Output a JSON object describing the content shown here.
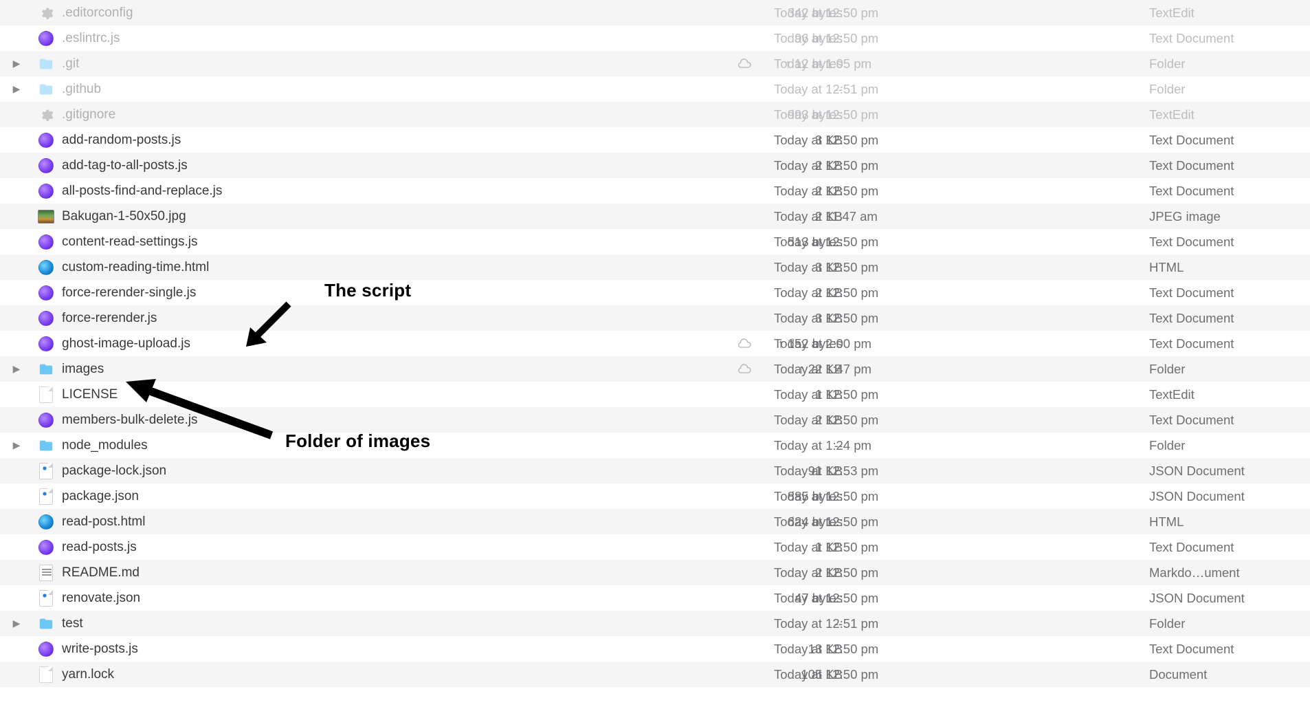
{
  "annotations": {
    "script_label": "The script",
    "folder_label": "Folder of images"
  },
  "rows": [
    {
      "name": ".editorconfig",
      "modified": "Today at 12:50 pm",
      "size": "342 bytes",
      "kind": "TextEdit",
      "icon": "gear",
      "expandable": false,
      "cloud": "none",
      "dim": true,
      "alt": true
    },
    {
      "name": ".eslintrc.js",
      "modified": "Today at 12:50 pm",
      "size": "96 bytes",
      "kind": "Text Document",
      "icon": "js",
      "expandable": false,
      "cloud": "none",
      "dim": true,
      "alt": false
    },
    {
      "name": ".git",
      "modified": "Today at 1:05 pm",
      "size": "↑ 12 bytes",
      "kind": "Folder",
      "icon": "folder",
      "expandable": true,
      "cloud": "cloud",
      "dim": true,
      "alt": true
    },
    {
      "name": ".github",
      "modified": "Today at 12:51 pm",
      "size": "--",
      "kind": "Folder",
      "icon": "folder",
      "expandable": true,
      "cloud": "none",
      "dim": true,
      "alt": false
    },
    {
      "name": ".gitignore",
      "modified": "Today at 12:50 pm",
      "size": "993 bytes",
      "kind": "TextEdit",
      "icon": "gear",
      "expandable": false,
      "cloud": "none",
      "dim": true,
      "alt": true
    },
    {
      "name": "add-random-posts.js",
      "modified": "Today at 12:50 pm",
      "size": "3 KB",
      "kind": "Text Document",
      "icon": "js",
      "expandable": false,
      "cloud": "none",
      "dim": false,
      "alt": false
    },
    {
      "name": "add-tag-to-all-posts.js",
      "modified": "Today at 12:50 pm",
      "size": "2 KB",
      "kind": "Text Document",
      "icon": "js",
      "expandable": false,
      "cloud": "none",
      "dim": false,
      "alt": true
    },
    {
      "name": "all-posts-find-and-replace.js",
      "modified": "Today at 12:50 pm",
      "size": "2 KB",
      "kind": "Text Document",
      "icon": "js",
      "expandable": false,
      "cloud": "none",
      "dim": false,
      "alt": false
    },
    {
      "name": "Bakugan-1-50x50.jpg",
      "modified": "Today at 11:47 am",
      "size": "2 KB",
      "kind": "JPEG image",
      "icon": "thumb",
      "expandable": false,
      "cloud": "none",
      "dim": false,
      "alt": true
    },
    {
      "name": "content-read-settings.js",
      "modified": "Today at 12:50 pm",
      "size": "513 bytes",
      "kind": "Text Document",
      "icon": "js",
      "expandable": false,
      "cloud": "none",
      "dim": false,
      "alt": false
    },
    {
      "name": "custom-reading-time.html",
      "modified": "Today at 12:50 pm",
      "size": "3 KB",
      "kind": "HTML",
      "icon": "html",
      "expandable": false,
      "cloud": "none",
      "dim": false,
      "alt": true
    },
    {
      "name": "force-rerender-single.js",
      "modified": "Today at 12:50 pm",
      "size": "2 KB",
      "kind": "Text Document",
      "icon": "js",
      "expandable": false,
      "cloud": "none",
      "dim": false,
      "alt": false
    },
    {
      "name": "force-rerender.js",
      "modified": "Today at 12:50 pm",
      "size": "3 KB",
      "kind": "Text Document",
      "icon": "js",
      "expandable": false,
      "cloud": "none",
      "dim": false,
      "alt": true
    },
    {
      "name": "ghost-image-upload.js",
      "modified": "Today at 2:00 pm",
      "size": "↑ 152 bytes",
      "kind": "Text Document",
      "icon": "js",
      "expandable": false,
      "cloud": "cloud",
      "dim": false,
      "alt": false
    },
    {
      "name": "images",
      "modified": "Today at 1:47 pm",
      "size": "↑ 22 KB",
      "kind": "Folder",
      "icon": "folder",
      "expandable": true,
      "cloud": "cloud",
      "dim": false,
      "alt": true
    },
    {
      "name": "LICENSE",
      "modified": "Today at 12:50 pm",
      "size": "1 KB",
      "kind": "TextEdit",
      "icon": "blank",
      "expandable": false,
      "cloud": "none",
      "dim": false,
      "alt": false
    },
    {
      "name": "members-bulk-delete.js",
      "modified": "Today at 12:50 pm",
      "size": "2 KB",
      "kind": "Text Document",
      "icon": "js",
      "expandable": false,
      "cloud": "none",
      "dim": false,
      "alt": true
    },
    {
      "name": "node_modules",
      "modified": "Today at 1:24 pm",
      "size": "--",
      "kind": "Folder",
      "icon": "folder",
      "expandable": true,
      "cloud": "none",
      "dim": false,
      "alt": false
    },
    {
      "name": "package-lock.json",
      "modified": "Today at 12:53 pm",
      "size": "91 KB",
      "kind": "JSON Document",
      "icon": "json",
      "expandable": false,
      "cloud": "none",
      "dim": false,
      "alt": true
    },
    {
      "name": "package.json",
      "modified": "Today at 12:50 pm",
      "size": "885 bytes",
      "kind": "JSON Document",
      "icon": "json",
      "expandable": false,
      "cloud": "none",
      "dim": false,
      "alt": false
    },
    {
      "name": "read-post.html",
      "modified": "Today at 12:50 pm",
      "size": "624 bytes",
      "kind": "HTML",
      "icon": "html",
      "expandable": false,
      "cloud": "none",
      "dim": false,
      "alt": true
    },
    {
      "name": "read-posts.js",
      "modified": "Today at 12:50 pm",
      "size": "1 KB",
      "kind": "Text Document",
      "icon": "js",
      "expandable": false,
      "cloud": "none",
      "dim": false,
      "alt": false
    },
    {
      "name": "README.md",
      "modified": "Today at 12:50 pm",
      "size": "2 KB",
      "kind": "Markdo…ument",
      "icon": "md",
      "expandable": false,
      "cloud": "none",
      "dim": false,
      "alt": true
    },
    {
      "name": "renovate.json",
      "modified": "Today at 12:50 pm",
      "size": "47 bytes",
      "kind": "JSON Document",
      "icon": "json",
      "expandable": false,
      "cloud": "none",
      "dim": false,
      "alt": false
    },
    {
      "name": "test",
      "modified": "Today at 12:51 pm",
      "size": "--",
      "kind": "Folder",
      "icon": "folder",
      "expandable": true,
      "cloud": "none",
      "dim": false,
      "alt": true
    },
    {
      "name": "write-posts.js",
      "modified": "Today at 12:50 pm",
      "size": "13 KB",
      "kind": "Text Document",
      "icon": "js",
      "expandable": false,
      "cloud": "none",
      "dim": false,
      "alt": false
    },
    {
      "name": "yarn.lock",
      "modified": "Today at 12:50 pm",
      "size": "105 KB",
      "kind": "Document",
      "icon": "blank",
      "expandable": false,
      "cloud": "none",
      "dim": false,
      "alt": true
    }
  ]
}
